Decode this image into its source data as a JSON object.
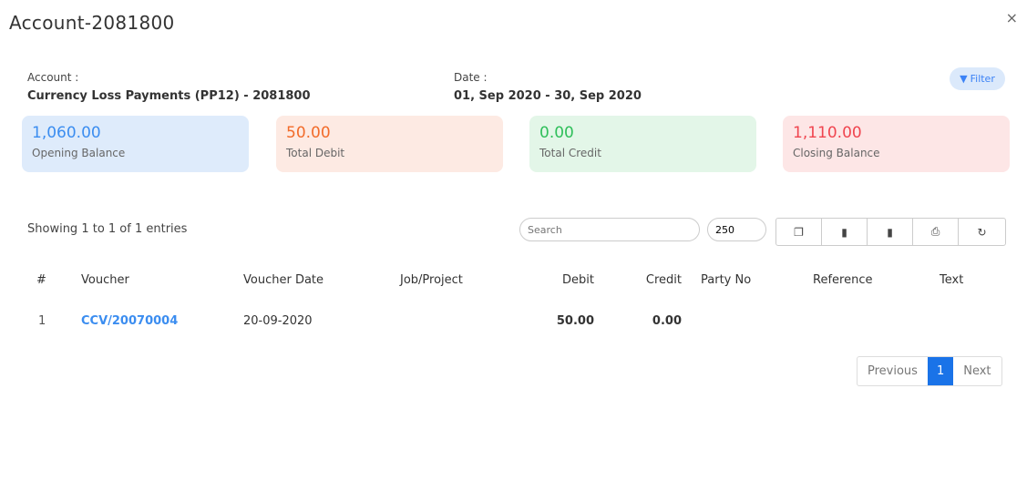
{
  "title": "Account-2081800",
  "close": "×",
  "account_label": "Account :",
  "account_value": "Currency Loss Payments (PP12) - 2081800",
  "date_label": "Date :",
  "date_value": "01, Sep 2020 - 30, Sep 2020",
  "filter_label": "Filter",
  "cards": [
    {
      "value": "1,060.00",
      "label": "Opening Balance",
      "color": "#3b8df0",
      "bg": "#deebfb"
    },
    {
      "value": "50.00",
      "label": "Total Debit",
      "color": "#f26b2a",
      "bg": "#fdeae3"
    },
    {
      "value": "0.00",
      "label": "Total Credit",
      "color": "#2fbf5a",
      "bg": "#e3f6e8"
    },
    {
      "value": "1,110.00",
      "label": "Closing Balance",
      "color": "#f0454f",
      "bg": "#fde6e6"
    }
  ],
  "showing": "Showing 1 to 1 of 1 entries",
  "search_placeholder": "Search",
  "page_length": "250",
  "toolbar": [
    "copy-icon",
    "csv-icon",
    "excel-icon",
    "print-icon",
    "refresh-icon"
  ],
  "columns": [
    "#",
    "Voucher",
    "Voucher Date",
    "Job/Project",
    "Debit",
    "Credit",
    "Party No",
    "Reference",
    "Text"
  ],
  "rows": [
    {
      "no": "1",
      "voucher": "CCV/20070004",
      "date": "20-09-2020",
      "job": "",
      "debit": "50.00",
      "credit": "0.00",
      "party": "",
      "reference": "",
      "text": ""
    }
  ],
  "pagination": {
    "previous": "Previous",
    "current": "1",
    "next": "Next"
  }
}
